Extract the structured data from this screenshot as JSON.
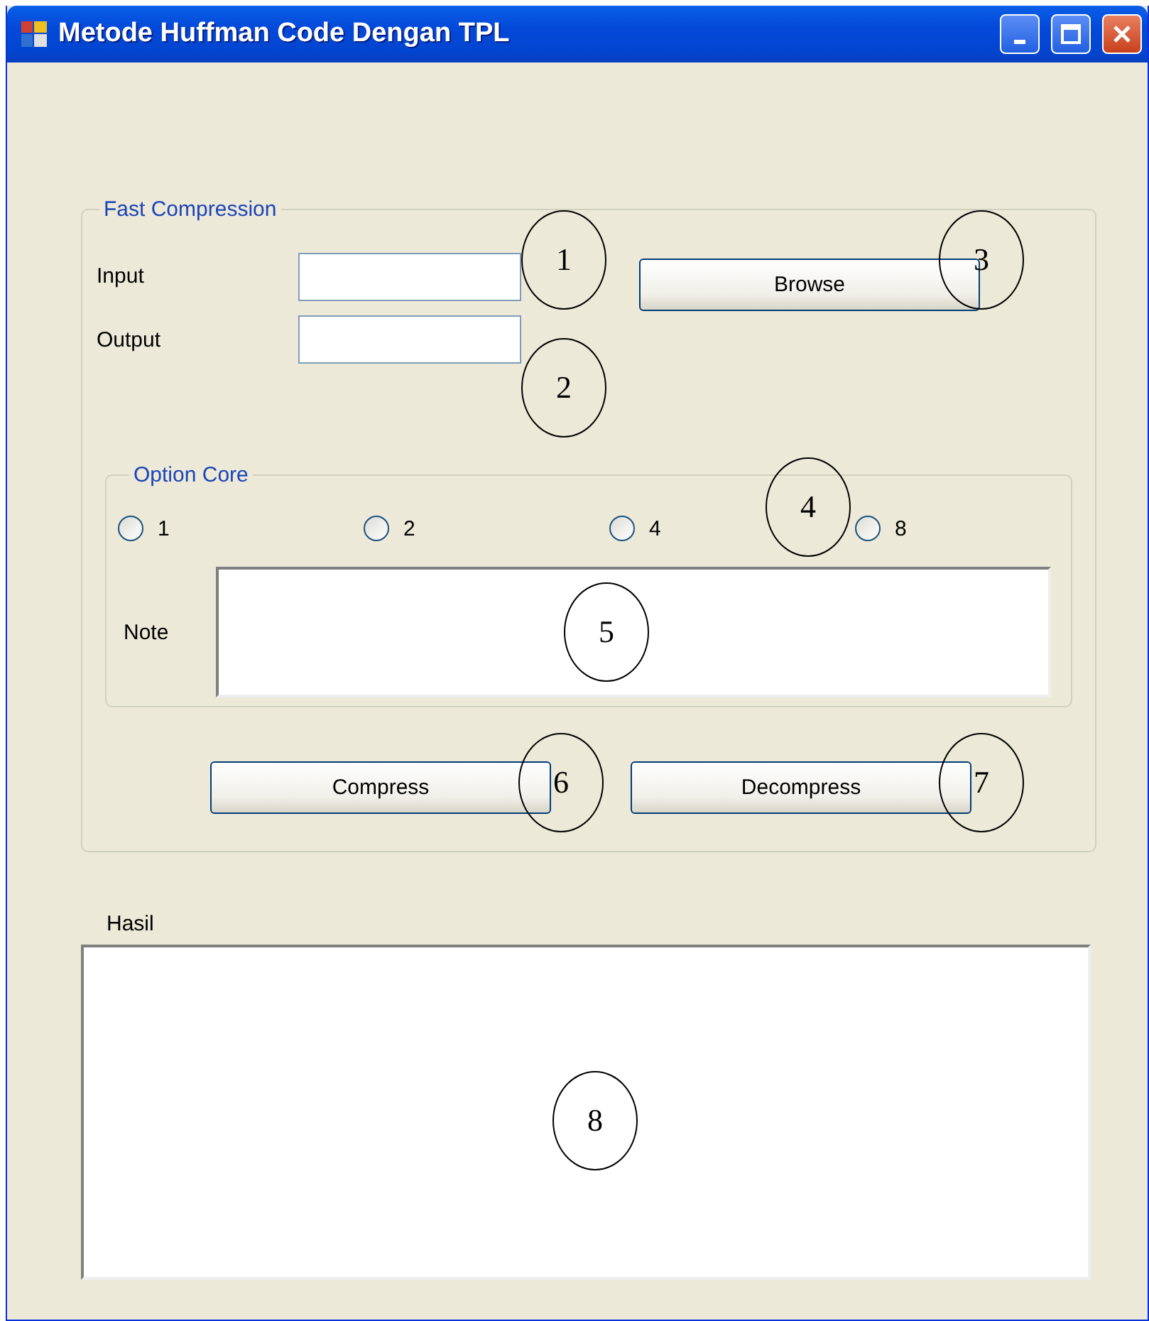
{
  "window": {
    "title": "Metode Huffman Code Dengan TPL"
  },
  "fast_compression": {
    "legend": "Fast Compression",
    "input": {
      "label": "Input"
    },
    "output": {
      "label": "Output"
    },
    "browse_button": "Browse",
    "option_core": {
      "legend": "Option Core",
      "radios": [
        {
          "label": "1",
          "selected": false
        },
        {
          "label": "2",
          "selected": false
        },
        {
          "label": "4",
          "selected": false
        },
        {
          "label": "8",
          "selected": false
        }
      ],
      "note": {
        "label": "Note"
      }
    },
    "buttons": [
      "Compress",
      "Decompress"
    ]
  },
  "result": {
    "label": "Hasil"
  },
  "annotations": [
    "1",
    "2",
    "3",
    "4",
    "5",
    "6",
    "7",
    "8"
  ]
}
